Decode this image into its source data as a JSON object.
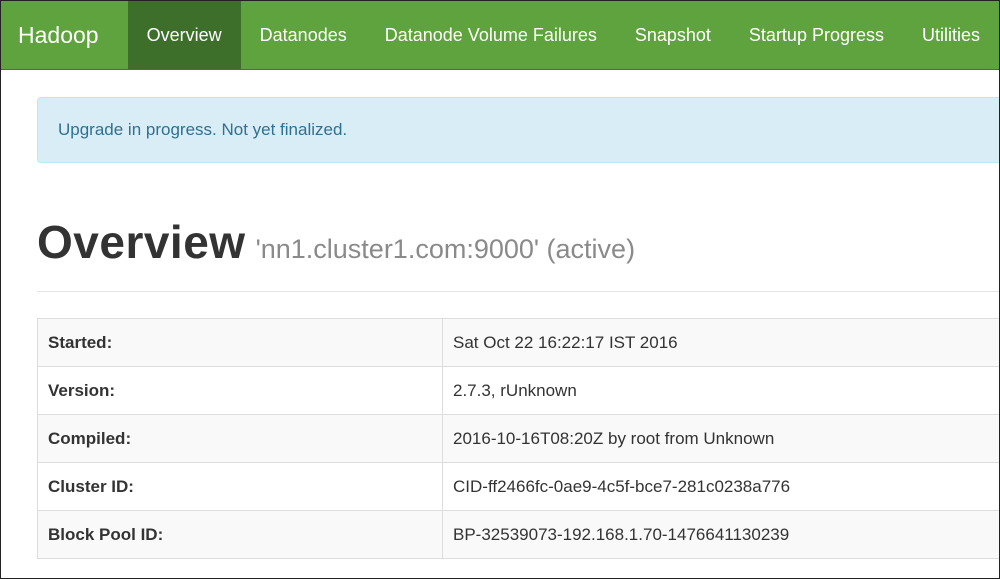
{
  "navbar": {
    "brand": "Hadoop",
    "items": [
      {
        "label": "Overview",
        "active": true
      },
      {
        "label": "Datanodes",
        "active": false
      },
      {
        "label": "Datanode Volume Failures",
        "active": false
      },
      {
        "label": "Snapshot",
        "active": false
      },
      {
        "label": "Startup Progress",
        "active": false
      },
      {
        "label": "Utilities",
        "active": false
      }
    ]
  },
  "alert": {
    "message": "Upgrade in progress. Not yet finalized."
  },
  "page": {
    "title": "Overview",
    "subtitle": "'nn1.cluster1.com:9000' (active)"
  },
  "info_table": {
    "rows": [
      {
        "key": "Started:",
        "value": "Sat Oct 22 16:22:17 IST 2016"
      },
      {
        "key": "Version:",
        "value": "2.7.3, rUnknown"
      },
      {
        "key": "Compiled:",
        "value": "2016-10-16T08:20Z by root from Unknown"
      },
      {
        "key": "Cluster ID:",
        "value": "CID-ff2466fc-0ae9-4c5f-bce7-281c0238a776"
      },
      {
        "key": "Block Pool ID:",
        "value": "BP-32539073-192.168.1.70-1476641130239"
      }
    ]
  },
  "colors": {
    "navbar_green": "#5fa33e",
    "navbar_active": "#3e6f2a",
    "alert_background": "#d9edf7",
    "alert_text": "#31708f"
  }
}
